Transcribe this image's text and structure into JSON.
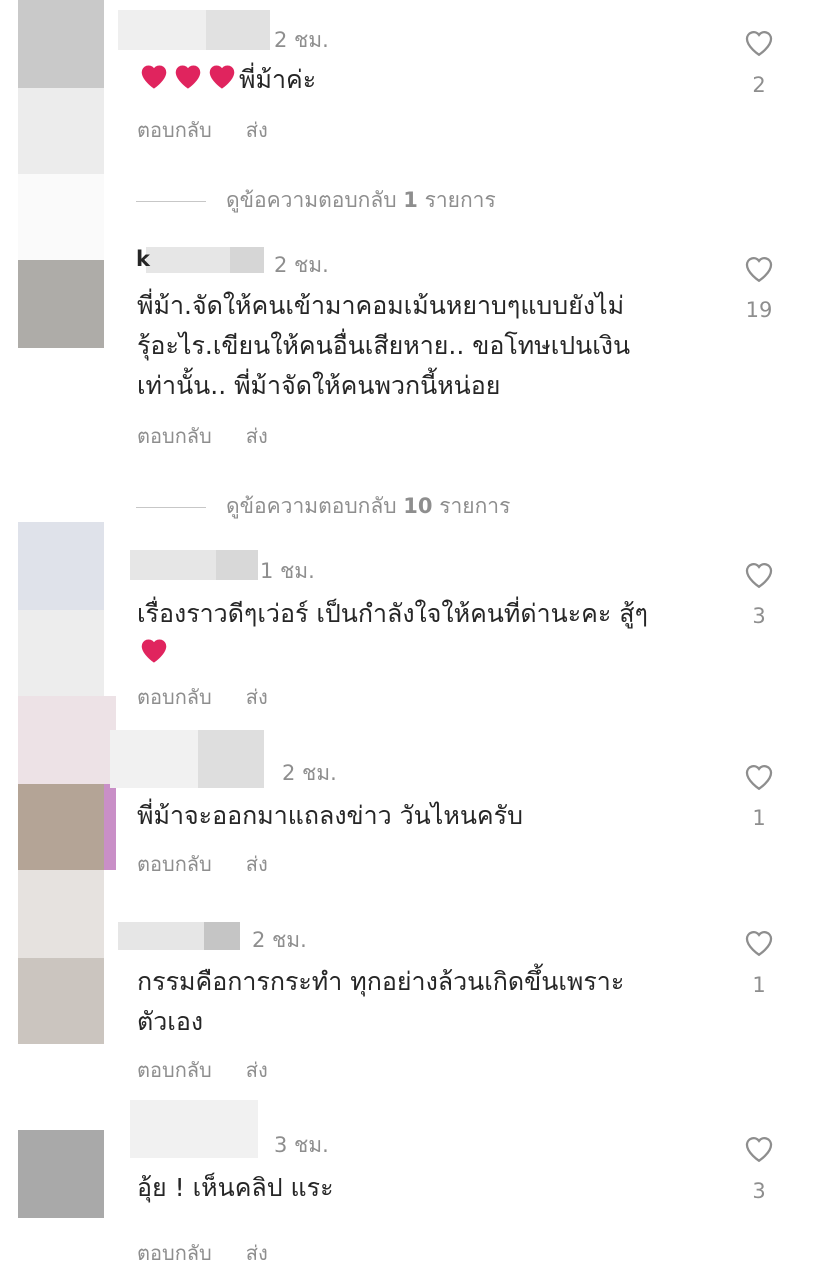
{
  "comments": [
    {
      "time": "2 ชม.",
      "text_lines": [
        "พี่ม้าค่ะ"
      ],
      "emoji_prefix_hearts": 3,
      "likes": "2",
      "reply_label": "ตอบกลับ",
      "send_label": "ส่ง",
      "view_replies": {
        "prefix": "ดูข้อความตอบกลับ",
        "count": "1",
        "suffix": "รายการ"
      }
    },
    {
      "username_initial": "k",
      "time": "2 ชม.",
      "text_lines": [
        "พี่ม้า.จัดให้คนเข้ามาคอมเม้นหยาบๆแบบยังไม่",
        "รุ้อะไร.เขียนให้คนอื่นเสียหาย.. ขอโทษเปนเงิน",
        "เท่านั้น.. พี่ม้าจัดให้คนพวกนี้หน่อย"
      ],
      "likes": "19",
      "reply_label": "ตอบกลับ",
      "send_label": "ส่ง",
      "view_replies": {
        "prefix": "ดูข้อความตอบกลับ",
        "count": "10",
        "suffix": "รายการ"
      }
    },
    {
      "time": "1 ชม.",
      "text_lines": [
        "เรื่องราวดีๆเว่อร์ เป็นกำลังใจให้คนที่ด่านะคะ สู้ๆ"
      ],
      "emoji_suffix_hearts": 1,
      "likes": "3",
      "reply_label": "ตอบกลับ",
      "send_label": "ส่ง"
    },
    {
      "time": "2 ชม.",
      "text_lines": [
        "พี่ม้าจะออกมาแถลงข่าว วันไหนครับ"
      ],
      "likes": "1",
      "reply_label": "ตอบกลับ",
      "send_label": "ส่ง"
    },
    {
      "time": "2 ชม.",
      "text_lines": [
        "กรรมคือการกระทำ ทุกอย่างล้วนเกิดขึ้นเพราะ",
        "ตัวเอง"
      ],
      "likes": "1",
      "reply_label": "ตอบกลับ",
      "send_label": "ส่ง"
    },
    {
      "time": "3 ชม.",
      "text_lines": [
        "อุ้ย ! เห็นคลิป แระ"
      ],
      "likes": "3",
      "reply_label": "ตอบกลับ",
      "send_label": "ส่ง"
    }
  ],
  "icons": {
    "like": "heart-outline-icon",
    "emoji": "red-heart-emoji"
  },
  "colors": {
    "text": "#262626",
    "muted": "#8e8e8e",
    "heart": "#e0245e"
  }
}
